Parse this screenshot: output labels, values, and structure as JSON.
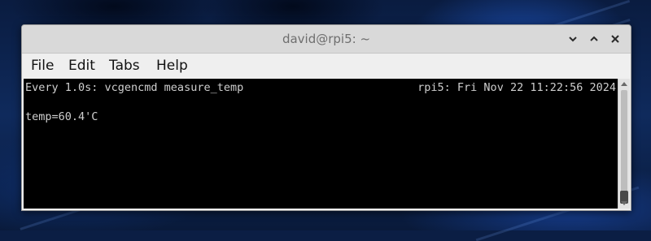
{
  "window": {
    "title": "david@rpi5: ~",
    "controls": {
      "minimize_icon": "chevron-down-icon",
      "maximize_icon": "chevron-up-icon",
      "close_icon": "close-icon"
    }
  },
  "menubar": {
    "items": [
      {
        "label": "File"
      },
      {
        "label": "Edit"
      },
      {
        "label": "Tabs"
      },
      {
        "label": "Help"
      }
    ]
  },
  "terminal": {
    "header_left": "Every 1.0s: vcgencmd measure_temp",
    "header_right": "rpi5: Fri Nov 22 11:22:56 2024",
    "output": "temp=60.4'C"
  },
  "colors": {
    "terminal_bg": "#000000",
    "terminal_fg": "#cfcfcf",
    "titlebar_bg": "#d9d9d9",
    "menubar_bg": "#efefef"
  }
}
